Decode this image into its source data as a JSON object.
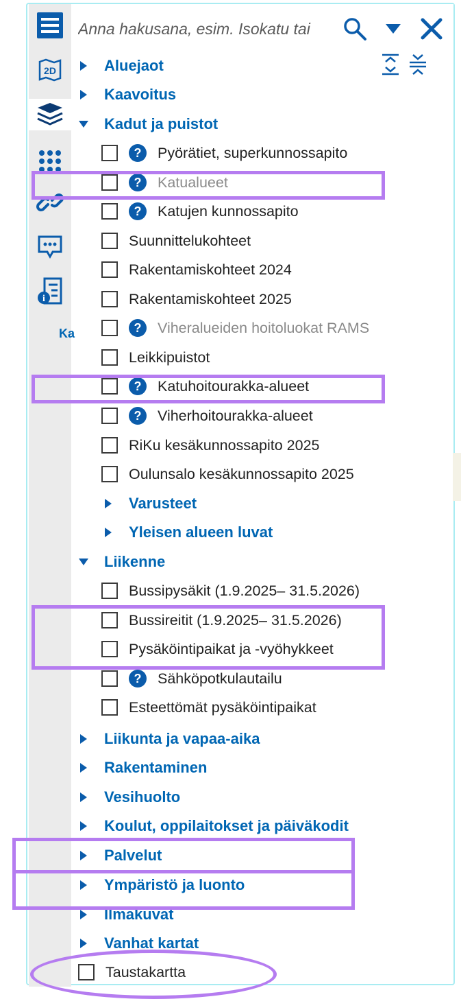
{
  "search": {
    "placeholder": "Anna hakusana, esim. Isokatu tai"
  },
  "toolbar": {
    "menu_icon": "hamburger-menu-icon",
    "map_2d_label": "2D",
    "peek_text": "Ka"
  },
  "tree": {
    "cat_aluejaot": "Aluejaot",
    "cat_kaavoitus": "Kaavoitus",
    "cat_kadut": "Kadut ja puistot",
    "layer_pyoratiet": "Pyörätiet, superkunnossapito",
    "layer_katualueet": "Katualueet",
    "layer_katujen": "Katujen kunnossapito",
    "layer_suunnittelu": "Suunnittelukohteet",
    "layer_rak2024": "Rakentamiskohteet 2024",
    "layer_rak2025": "Rakentamiskohteet 2025",
    "layer_viheralueiden": "Viheralueiden hoitoluokat RAMS",
    "layer_leikkipuistot": "Leikkipuistot",
    "layer_katuhoito": "Katuhoitourakka-alueet",
    "layer_viherhoito": "Viherhoitourakka-alueet",
    "layer_riku": "RiKu kesäkunnossapito 2025",
    "layer_oulunsalo": "Oulunsalo kesäkunnossapito 2025",
    "sub_varusteet": "Varusteet",
    "sub_yleisen": "Yleisen alueen luvat",
    "cat_liikenne": "Liikenne",
    "layer_bussipysakit": "Bussipysäkit (1.9.2025– 31.5.2026)",
    "layer_bussireitit": "Bussireitit (1.9.2025– 31.5.2026)",
    "layer_pysakointi": "Pysäköintipaikat ja -vyöhykkeet",
    "layer_sahkopotkulauta": "Sähköpotkulautailu",
    "layer_esteettomat": "Esteettömät pysäköintipaikat",
    "cat_liikunta": "Liikunta ja vapaa-aika",
    "cat_rakentaminen": "Rakentaminen",
    "cat_vesihuolto": "Vesihuolto",
    "cat_koulut": "Koulut, oppilaitokset ja päiväkodit",
    "cat_palvelut": "Palvelut",
    "cat_ymparisto": "Ympäristö ja luonto",
    "cat_ilmakuvat": "Ilmakuvat",
    "cat_vanhat": "Vanhat kartat",
    "layer_taustakartta": "Taustakartta",
    "help_glyph": "?"
  },
  "colors": {
    "accent": "#0066b3",
    "help_icon": "#0b5cab",
    "highlight": "#b57cf0",
    "frame": "#a9ecf2",
    "toolbar_bg": "#ebebeb"
  }
}
